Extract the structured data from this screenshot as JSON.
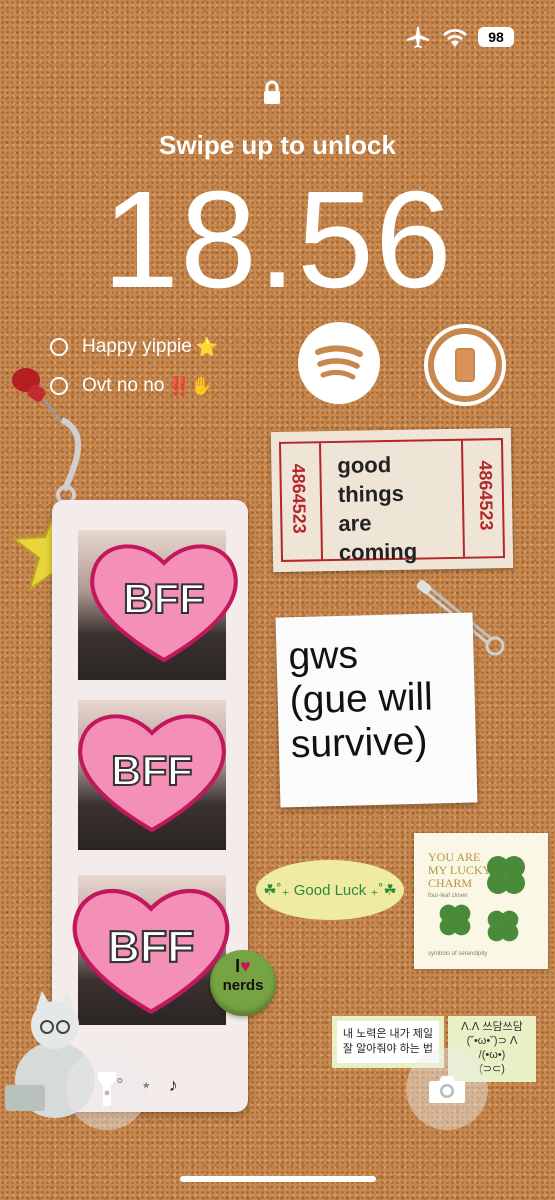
{
  "status_bar": {
    "airplane_icon": "airplane-icon",
    "wifi_icon": "wifi-icon",
    "battery": "98"
  },
  "lock": {
    "icon": "lock-icon",
    "swipe_text": "Swipe up to unlock",
    "time": "18.56"
  },
  "reminders": {
    "items": [
      {
        "label": "Happy yippie",
        "emoji": "⭐"
      },
      {
        "label": "Ovt no no",
        "emoji": "‼️✋"
      }
    ]
  },
  "widgets": {
    "spotify_icon": "spotify-icon",
    "phone_icon": "phone-icon"
  },
  "photo_strip": {
    "heart_label": "BFF",
    "footer": "° ⋆ ♪"
  },
  "ticket": {
    "number": "4864523",
    "lines": [
      "good",
      "things",
      "are",
      "coming"
    ]
  },
  "note": {
    "lines": [
      "gws",
      "(gue will",
      "survive)"
    ]
  },
  "good_luck": {
    "text": "☘︎˚₊ Good Luck ₊˚☘︎"
  },
  "stamp": {
    "lines": [
      "YOU ARE",
      "MY LUCKY",
      "CHARM"
    ],
    "subtitle": "four-leaf clover",
    "footer": "symbols of serendipity"
  },
  "korean_sticker": {
    "line1": "내 노력은 내가 제일",
    "line2": "잘 알아줘야 하는 법"
  },
  "kaomoji_sticker": {
    "line1": "ᐱ.ᐱ  쓰담쓰담",
    "line2": "(˘•ω•˘)⊃ ᐱ",
    "line3": "/(•ω•)",
    "line4": "(⊃⊂)"
  },
  "nerds_button": {
    "top": "I",
    "bottom": "nerds"
  },
  "bottom_controls": {
    "flashlight_icon": "flashlight-icon",
    "camera_icon": "camera-icon"
  },
  "colors": {
    "cork": "#c7874d",
    "ticket_red": "#b5262a",
    "heart_pink": "#f48fb8",
    "clover_green": "#2f8a3a"
  }
}
